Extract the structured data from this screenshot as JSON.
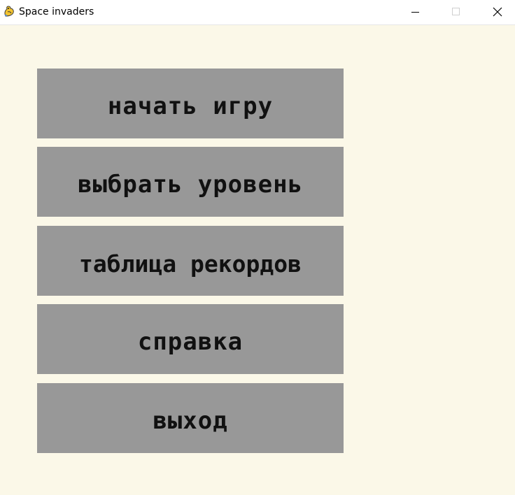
{
  "window": {
    "title": "Space invaders",
    "app_icon": "pygame-snake-icon",
    "controls": {
      "minimize_icon": "minimize-icon",
      "maximize_icon": "maximize-icon",
      "close_icon": "close-icon"
    }
  },
  "colors": {
    "background": "#fbf8e8",
    "button_fill": "#989898",
    "button_text": "#111111"
  },
  "menu": {
    "items": [
      {
        "label": "начать игру"
      },
      {
        "label": "выбрать уровень"
      },
      {
        "label": "таблица рекордов"
      },
      {
        "label": "справка"
      },
      {
        "label": "выход"
      }
    ]
  }
}
